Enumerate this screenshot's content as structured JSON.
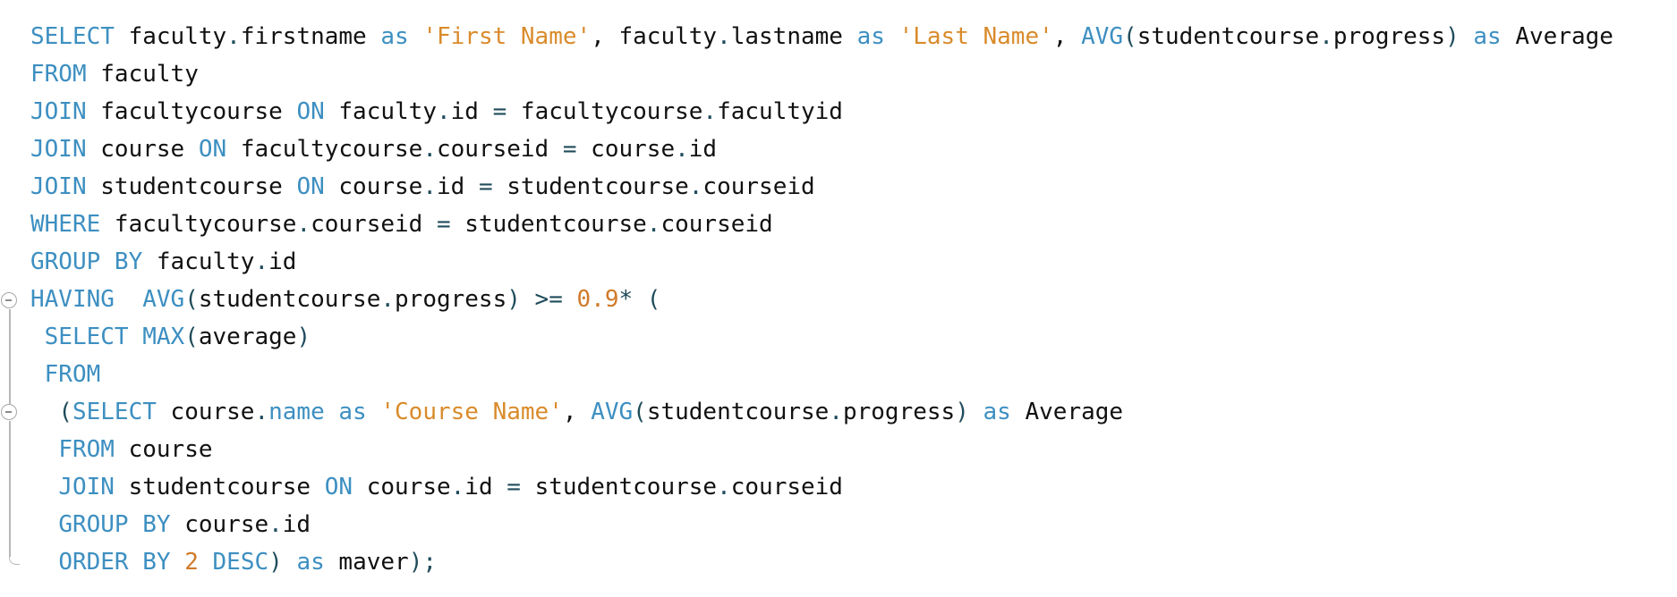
{
  "editor": {
    "colors": {
      "keyword": "#3d8fc1",
      "string": "#d98b2b",
      "number": "#d07a28",
      "operator": "#1f4c5b",
      "identifier": "#111111",
      "fold_guide": "#b7b7b7"
    },
    "fold_icons": [
      "minus-circle-icon",
      "minus-circle-icon"
    ],
    "lines": [
      {
        "tokens": [
          {
            "text": "SELECT",
            "type": "kw"
          },
          {
            "text": " ",
            "type": "ident"
          },
          {
            "text": "faculty",
            "type": "ident"
          },
          {
            "text": ".",
            "type": "op"
          },
          {
            "text": "firstname",
            "type": "ident"
          },
          {
            "text": " ",
            "type": "ident"
          },
          {
            "text": "as",
            "type": "kw"
          },
          {
            "text": " ",
            "type": "ident"
          },
          {
            "text": "'First Name'",
            "type": "str"
          },
          {
            "text": ", ",
            "type": "ident"
          },
          {
            "text": "faculty",
            "type": "ident"
          },
          {
            "text": ".",
            "type": "op"
          },
          {
            "text": "lastname",
            "type": "ident"
          },
          {
            "text": " ",
            "type": "ident"
          },
          {
            "text": "as",
            "type": "kw"
          },
          {
            "text": " ",
            "type": "ident"
          },
          {
            "text": "'Last Name'",
            "type": "str"
          },
          {
            "text": ", ",
            "type": "ident"
          },
          {
            "text": "AVG",
            "type": "kw"
          },
          {
            "text": "(",
            "type": "op"
          },
          {
            "text": "studentcourse",
            "type": "ident"
          },
          {
            "text": ".",
            "type": "op"
          },
          {
            "text": "progress",
            "type": "ident"
          },
          {
            "text": ")",
            "type": "op"
          },
          {
            "text": " ",
            "type": "ident"
          },
          {
            "text": "as",
            "type": "kw"
          },
          {
            "text": " ",
            "type": "ident"
          },
          {
            "text": "Average",
            "type": "ident"
          }
        ]
      },
      {
        "tokens": [
          {
            "text": "FROM",
            "type": "kw"
          },
          {
            "text": " faculty",
            "type": "ident"
          }
        ]
      },
      {
        "tokens": [
          {
            "text": "JOIN",
            "type": "kw"
          },
          {
            "text": " facultycourse ",
            "type": "ident"
          },
          {
            "text": "ON",
            "type": "kw"
          },
          {
            "text": " faculty",
            "type": "ident"
          },
          {
            "text": ".",
            "type": "op"
          },
          {
            "text": "id ",
            "type": "ident"
          },
          {
            "text": "=",
            "type": "op"
          },
          {
            "text": " facultycourse",
            "type": "ident"
          },
          {
            "text": ".",
            "type": "op"
          },
          {
            "text": "facultyid",
            "type": "ident"
          }
        ]
      },
      {
        "tokens": [
          {
            "text": "JOIN",
            "type": "kw"
          },
          {
            "text": " course ",
            "type": "ident"
          },
          {
            "text": "ON",
            "type": "kw"
          },
          {
            "text": " facultycourse",
            "type": "ident"
          },
          {
            "text": ".",
            "type": "op"
          },
          {
            "text": "courseid ",
            "type": "ident"
          },
          {
            "text": "=",
            "type": "op"
          },
          {
            "text": " course",
            "type": "ident"
          },
          {
            "text": ".",
            "type": "op"
          },
          {
            "text": "id",
            "type": "ident"
          }
        ]
      },
      {
        "tokens": [
          {
            "text": "JOIN",
            "type": "kw"
          },
          {
            "text": " studentcourse ",
            "type": "ident"
          },
          {
            "text": "ON",
            "type": "kw"
          },
          {
            "text": " course",
            "type": "ident"
          },
          {
            "text": ".",
            "type": "op"
          },
          {
            "text": "id ",
            "type": "ident"
          },
          {
            "text": "=",
            "type": "op"
          },
          {
            "text": " studentcourse",
            "type": "ident"
          },
          {
            "text": ".",
            "type": "op"
          },
          {
            "text": "courseid",
            "type": "ident"
          }
        ]
      },
      {
        "tokens": [
          {
            "text": "WHERE",
            "type": "kw"
          },
          {
            "text": " facultycourse",
            "type": "ident"
          },
          {
            "text": ".",
            "type": "op"
          },
          {
            "text": "courseid ",
            "type": "ident"
          },
          {
            "text": "=",
            "type": "op"
          },
          {
            "text": " studentcourse",
            "type": "ident"
          },
          {
            "text": ".",
            "type": "op"
          },
          {
            "text": "courseid",
            "type": "ident"
          }
        ]
      },
      {
        "tokens": [
          {
            "text": "GROUP BY",
            "type": "kw"
          },
          {
            "text": " faculty",
            "type": "ident"
          },
          {
            "text": ".",
            "type": "op"
          },
          {
            "text": "id",
            "type": "ident"
          }
        ]
      },
      {
        "tokens": [
          {
            "text": "HAVING",
            "type": "kw"
          },
          {
            "text": "  ",
            "type": "ident"
          },
          {
            "text": "AVG",
            "type": "kw"
          },
          {
            "text": "(",
            "type": "op"
          },
          {
            "text": "studentcourse",
            "type": "ident"
          },
          {
            "text": ".",
            "type": "op"
          },
          {
            "text": "progress",
            "type": "ident"
          },
          {
            "text": ") >= ",
            "type": "op"
          },
          {
            "text": "0.9",
            "type": "num"
          },
          {
            "text": "* (",
            "type": "op"
          }
        ]
      },
      {
        "tokens": [
          {
            "text": " ",
            "type": "ident"
          },
          {
            "text": "SELECT",
            "type": "kw"
          },
          {
            "text": " ",
            "type": "ident"
          },
          {
            "text": "MAX",
            "type": "kw"
          },
          {
            "text": "(",
            "type": "op"
          },
          {
            "text": "average",
            "type": "ident"
          },
          {
            "text": ")",
            "type": "op"
          }
        ]
      },
      {
        "tokens": [
          {
            "text": " ",
            "type": "ident"
          },
          {
            "text": "FROM",
            "type": "kw"
          }
        ]
      },
      {
        "tokens": [
          {
            "text": "  ",
            "type": "ident"
          },
          {
            "text": "(",
            "type": "op"
          },
          {
            "text": "SELECT",
            "type": "kw"
          },
          {
            "text": " course",
            "type": "ident"
          },
          {
            "text": ".",
            "type": "op"
          },
          {
            "text": "name",
            "type": "kw"
          },
          {
            "text": " ",
            "type": "ident"
          },
          {
            "text": "as",
            "type": "kw"
          },
          {
            "text": " ",
            "type": "ident"
          },
          {
            "text": "'Course Name'",
            "type": "str"
          },
          {
            "text": ", ",
            "type": "ident"
          },
          {
            "text": "AVG",
            "type": "kw"
          },
          {
            "text": "(",
            "type": "op"
          },
          {
            "text": "studentcourse",
            "type": "ident"
          },
          {
            "text": ".",
            "type": "op"
          },
          {
            "text": "progress",
            "type": "ident"
          },
          {
            "text": ")",
            "type": "op"
          },
          {
            "text": " ",
            "type": "ident"
          },
          {
            "text": "as",
            "type": "kw"
          },
          {
            "text": " Average",
            "type": "ident"
          }
        ]
      },
      {
        "tokens": [
          {
            "text": "  ",
            "type": "ident"
          },
          {
            "text": "FROM",
            "type": "kw"
          },
          {
            "text": " course",
            "type": "ident"
          }
        ]
      },
      {
        "tokens": [
          {
            "text": "  ",
            "type": "ident"
          },
          {
            "text": "JOIN",
            "type": "kw"
          },
          {
            "text": " studentcourse ",
            "type": "ident"
          },
          {
            "text": "ON",
            "type": "kw"
          },
          {
            "text": " course",
            "type": "ident"
          },
          {
            "text": ".",
            "type": "op"
          },
          {
            "text": "id ",
            "type": "ident"
          },
          {
            "text": "=",
            "type": "op"
          },
          {
            "text": " studentcourse",
            "type": "ident"
          },
          {
            "text": ".",
            "type": "op"
          },
          {
            "text": "courseid",
            "type": "ident"
          }
        ]
      },
      {
        "tokens": [
          {
            "text": "  ",
            "type": "ident"
          },
          {
            "text": "GROUP BY",
            "type": "kw"
          },
          {
            "text": " course",
            "type": "ident"
          },
          {
            "text": ".",
            "type": "op"
          },
          {
            "text": "id",
            "type": "ident"
          }
        ]
      },
      {
        "tokens": [
          {
            "text": "  ",
            "type": "ident"
          },
          {
            "text": "ORDER BY",
            "type": "kw"
          },
          {
            "text": " ",
            "type": "ident"
          },
          {
            "text": "2",
            "type": "num"
          },
          {
            "text": " ",
            "type": "ident"
          },
          {
            "text": "DESC",
            "type": "kw"
          },
          {
            "text": ") ",
            "type": "op"
          },
          {
            "text": "as",
            "type": "kw"
          },
          {
            "text": " maver",
            "type": "ident"
          },
          {
            "text": ");",
            "type": "op"
          }
        ]
      }
    ]
  }
}
